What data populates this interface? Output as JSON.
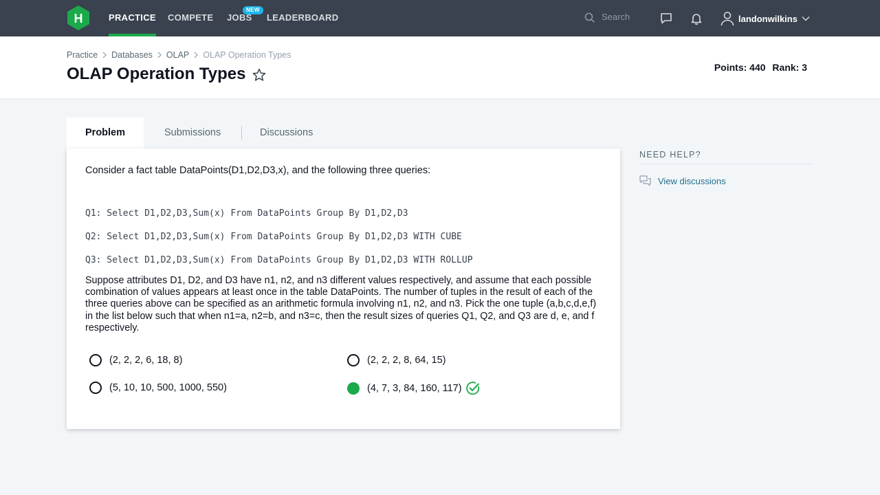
{
  "nav": {
    "logo_letter": "H",
    "items": [
      {
        "label": "PRACTICE"
      },
      {
        "label": "COMPETE"
      },
      {
        "label": "JOBS"
      },
      {
        "label": "LEADERBOARD"
      }
    ],
    "jobs_badge": "NEW",
    "search_placeholder": "Search",
    "username": "landonwilkins"
  },
  "breadcrumb": [
    "Practice",
    "Databases",
    "OLAP",
    "OLAP Operation Types"
  ],
  "page_title": "OLAP Operation Types",
  "score": {
    "points": "Points: 440",
    "rank": "Rank: 3"
  },
  "tabs": [
    {
      "label": "Problem"
    },
    {
      "label": "Submissions"
    },
    {
      "label": "Discussions"
    }
  ],
  "problem": {
    "intro": "Consider a fact table DataPoints(D1,D2,D3,x), and the following three queries:",
    "queries": [
      "Q1: Select D1,D2,D3,Sum(x) From DataPoints Group By D1,D2,D3",
      "Q2: Select D1,D2,D3,Sum(x) From DataPoints Group By D1,D2,D3 WITH CUBE",
      "Q3: Select D1,D2,D3,Sum(x) From DataPoints Group By D1,D2,D3 WITH ROLLUP"
    ],
    "description": "Suppose attributes D1, D2, and D3 have n1, n2, and n3 different values respectively, and assume that each possible combination of values appears at least once in the table DataPoints. The number of tuples in the result of each of the three queries above can be specified as an arithmetic formula involving n1, n2, and n3. Pick the one tuple (a,b,c,d,e,f) in the list below such that when n1=a, n2=b, and n3=c, then the result sizes of queries Q1, Q2, and Q3 are d, e, and f respectively.",
    "options": [
      {
        "label": "(2, 2, 2, 6, 18, 8)",
        "selected": false
      },
      {
        "label": "(2, 2, 2, 8, 64, 15)",
        "selected": false
      },
      {
        "label": "(5, 10, 10, 500, 1000, 550)",
        "selected": false
      },
      {
        "label": "(4, 7, 3, 84, 160, 117)",
        "selected": true,
        "correct": true
      }
    ]
  },
  "help": {
    "title": "NEED HELP?",
    "link": "View discussions"
  },
  "colors": {
    "nav_bg": "#39424e",
    "accent_green": "#1ba94c",
    "badge_blue": "#1cb7ed",
    "link_blue": "#1f6f8b"
  }
}
